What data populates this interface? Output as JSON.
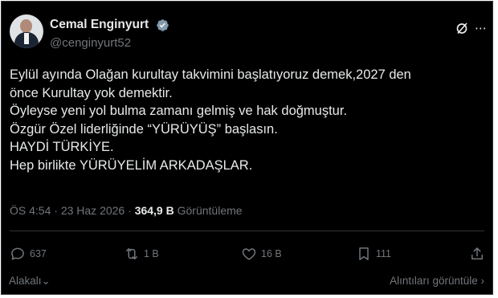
{
  "author": {
    "name": "Cemal Enginyurt",
    "handle": "@cenginyurt52"
  },
  "tweet": {
    "lines": [
      "Eylül ayında Olağan kurultay takvimini başlatıyoruz demek,2027 den",
      "önce Kurultay yok demektir.",
      "Öyleyse yeni yol bulma zamanı gelmiş ve hak doğmuştur.",
      "Özgür Özel liderliğinde “YÜRÜYÜŞ” başlasın.",
      "HAYDİ TÜRKİYE.",
      "Hep birlikte YÜRÜYELİM ARKADAŞLAR."
    ]
  },
  "meta": {
    "time": "ÖS 4:54",
    "separator": "·",
    "date": "23 Haz 2026",
    "views": "364,9 B",
    "views_label": "Görüntüleme"
  },
  "actions": {
    "replies": "637",
    "reposts": "1 B",
    "likes": "16 B",
    "bookmarks": "111"
  },
  "footer": {
    "related": "Alakalı",
    "quotes": "Alıntıları görüntüle"
  },
  "icons": [
    "verified-badge-icon",
    "grok-icon",
    "more-icon",
    "reply-icon",
    "repost-icon",
    "like-icon",
    "bookmark-icon",
    "share-icon",
    "chevron-down-icon",
    "chevron-right-icon"
  ],
  "colors": {
    "background": "#000000",
    "text": "#e7e9ea",
    "muted": "#71767b",
    "verified": "#829aab"
  }
}
